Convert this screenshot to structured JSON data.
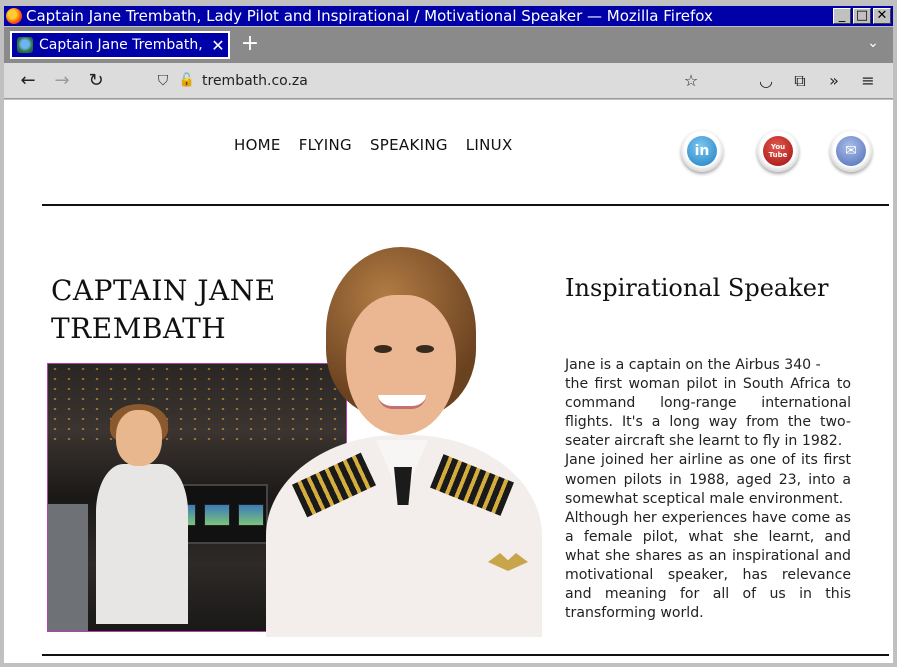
{
  "window": {
    "title": "Captain Jane Trembath, Lady Pilot and Inspirational / Motivational Speaker — Mozilla Firefox",
    "minimize": "_",
    "maximize": "□",
    "close": "✕"
  },
  "tabs": [
    {
      "label": "Captain Jane Trembath, L",
      "close": "✕"
    }
  ],
  "newtab": "+",
  "tablist": "⌄",
  "nav": {
    "back": "←",
    "forward": "→",
    "reload": "↻",
    "url": "trembath.co.za",
    "star": "☆",
    "pocket": "◡",
    "extensions": "⧉",
    "overflow": "»",
    "menu": "≡"
  },
  "site": {
    "menu": [
      "HOME",
      "FLYING",
      "SPEAKING",
      "LINUX"
    ],
    "social": {
      "linkedin": "in",
      "youtube": "You Tube",
      "mail": "✉"
    },
    "hero_title_line1": "CAPTAIN JANE",
    "hero_title_line2": "TREMBATH",
    "speaker_title": "Inspirational Speaker",
    "bio": [
      "Jane is a captain on the Airbus 340 -",
      "the first woman pilot in South Africa to command long-range international flights. It's a long way from the two-seater aircraft she learnt to fly in 1982.",
      "Jane joined her airline as one of its first women pilots in 1988, aged 23, into a somewhat sceptical male environment.",
      "Although her experiences have come as a female pilot, what she learnt, and what she shares as an inspirational and motivational speaker, has relevance and meaning for all of us in this transforming world."
    ]
  }
}
